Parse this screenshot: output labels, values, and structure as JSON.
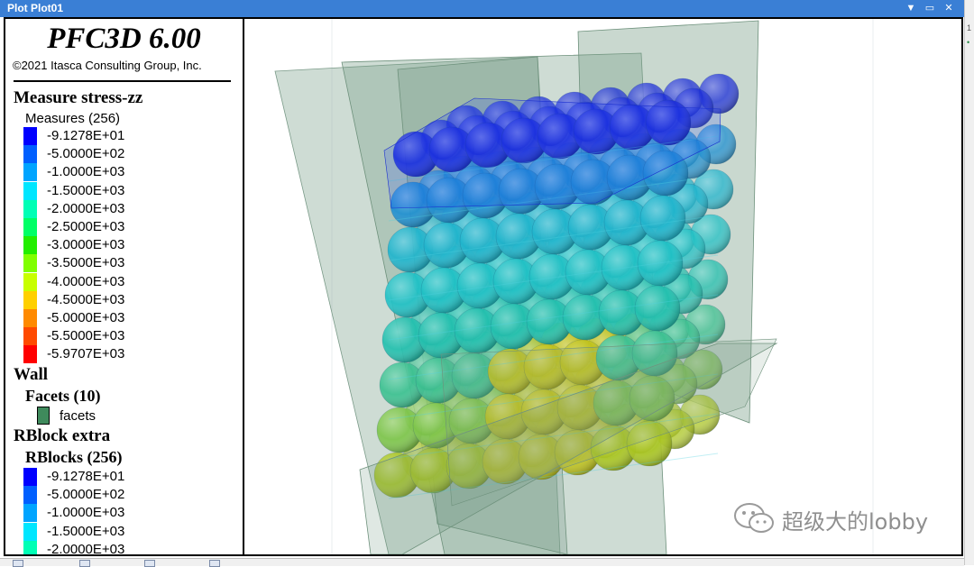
{
  "window": {
    "title": "Plot Plot01",
    "controls": {
      "menu": "▼",
      "restore": "▭",
      "close": "✕"
    }
  },
  "legend": {
    "app_name": "PFC3D 6.00",
    "copyright": "©2021 Itasca Consulting Group, Inc.",
    "measure_header": "Measure stress-zz",
    "measure_sub": "Measures (256)",
    "measure_items": [
      {
        "value": "-9.1278E+01",
        "color": "#0000ff"
      },
      {
        "value": "-5.0000E+02",
        "color": "#005fff"
      },
      {
        "value": "-1.0000E+03",
        "color": "#00a4ff"
      },
      {
        "value": "-1.5000E+03",
        "color": "#00e6ff"
      },
      {
        "value": "-2.0000E+03",
        "color": "#00ffb5"
      },
      {
        "value": "-2.5000E+03",
        "color": "#00ff66"
      },
      {
        "value": "-3.0000E+03",
        "color": "#22ee00"
      },
      {
        "value": "-3.5000E+03",
        "color": "#80ff00"
      },
      {
        "value": "-4.0000E+03",
        "color": "#c8ff00"
      },
      {
        "value": "-4.5000E+03",
        "color": "#ffd000"
      },
      {
        "value": "-5.0000E+03",
        "color": "#ff8a00"
      },
      {
        "value": "-5.5000E+03",
        "color": "#ff4a00"
      },
      {
        "value": "-5.9707E+03",
        "color": "#ff0000"
      }
    ],
    "wall_header": "Wall",
    "facets_sub": "Facets (10)",
    "facets_label": "facets",
    "facets_color": "#3f8a5c",
    "rblock_header": "RBlock extra",
    "rblocks_sub": "RBlocks (256)",
    "rblock_items": [
      {
        "value": "-9.1278E+01",
        "color": "#0000ff"
      },
      {
        "value": "-5.0000E+02",
        "color": "#005fff"
      },
      {
        "value": "-1.0000E+03",
        "color": "#00a4ff"
      },
      {
        "value": "-1.5000E+03",
        "color": "#00e6ff"
      },
      {
        "value": "-2.0000E+03",
        "color": "#00ffb5"
      }
    ]
  },
  "watermark": {
    "text": "超级大的lobby"
  }
}
